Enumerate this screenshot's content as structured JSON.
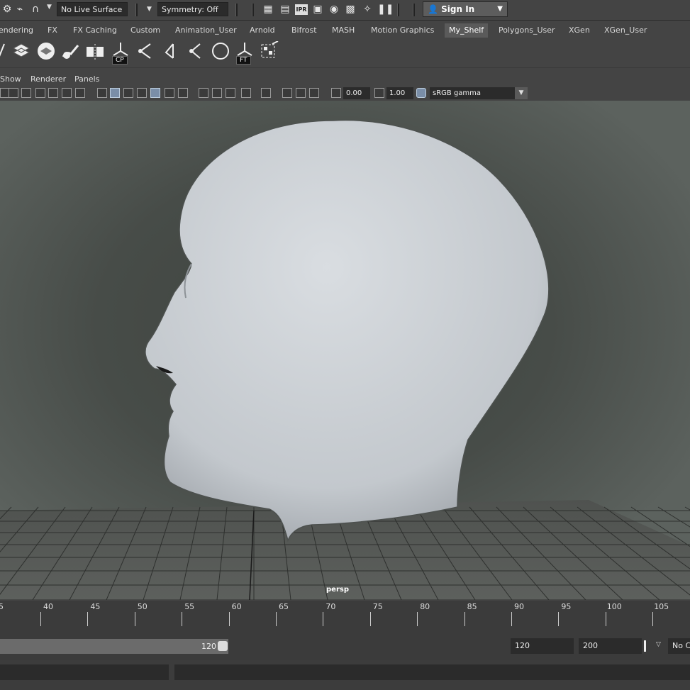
{
  "status_line": {
    "live_surface": "No Live Surface",
    "symmetry": "Symmetry: Off",
    "sign_in": "Sign In",
    "icons": [
      "lasso-icon",
      "snap-curve-icon",
      "magnet-icon",
      "render-view-icon",
      "render-icon",
      "ipr-render-icon",
      "render-settings-icon",
      "hypershade-icon",
      "render-setup-icon",
      "lights-icon",
      "pause-icon"
    ],
    "ipr_label": "IPR"
  },
  "shelf": {
    "tabs": [
      "endering",
      "FX",
      "FX Caching",
      "Custom",
      "Animation_User",
      "Arnold",
      "Bifrost",
      "MASH",
      "Motion Graphics",
      "My_Shelf",
      "Polygons_User",
      "XGen",
      "XGen_User"
    ],
    "active_tab": "My_Shelf",
    "icon_labels": {
      "cp": "CP",
      "ft": "FT"
    }
  },
  "panel_menu": [
    "Show",
    "Renderer",
    "Panels"
  ],
  "panel_toolbar": {
    "exposure": "0.00",
    "gamma": "1.00",
    "color_space": "sRGB gamma"
  },
  "viewport": {
    "camera_label": "persp",
    "background_color": "#545a56",
    "model_color": "#c7ccd0"
  },
  "timeline": {
    "ticks": [
      "40",
      "45",
      "50",
      "55",
      "60",
      "65",
      "70",
      "75",
      "80",
      "85",
      "90",
      "95",
      "100",
      "105"
    ],
    "first_partial": "5"
  },
  "range": {
    "end_value": "120",
    "playback_end": "120",
    "anim_end": "200",
    "char_set": "No C"
  }
}
